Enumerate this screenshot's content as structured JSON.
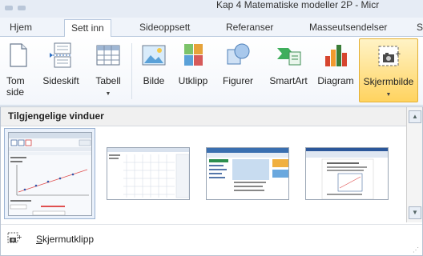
{
  "window": {
    "title": "Kap 4 Matematiske modeller 2P - Micr"
  },
  "tabs": [
    {
      "label": "Hjem",
      "active": false
    },
    {
      "label": "Sett inn",
      "active": true
    },
    {
      "label": "Sideoppsett",
      "active": false
    },
    {
      "label": "Referanser",
      "active": false
    },
    {
      "label": "Masseutsendelser",
      "active": false
    },
    {
      "label": "S",
      "active": false
    }
  ],
  "ribbon": {
    "buttons": [
      {
        "label": "Tom",
        "label2": "side",
        "icon": "blank-page-icon"
      },
      {
        "label": "Sideskift",
        "icon": "page-break-icon"
      },
      {
        "label": "Tabell",
        "icon": "table-icon",
        "dropdown": true
      },
      {
        "label": "Bilde",
        "icon": "picture-icon"
      },
      {
        "label": "Utklipp",
        "icon": "clip-art-icon"
      },
      {
        "label": "Figurer",
        "icon": "shapes-icon"
      },
      {
        "label": "SmartArt",
        "icon": "smartart-icon"
      },
      {
        "label": "Diagram",
        "icon": "chart-icon"
      },
      {
        "label": "Skjermbilde",
        "icon": "screenshot-icon",
        "dropdown": true,
        "highlighted": true
      }
    ]
  },
  "panel": {
    "header": "Tilgjengelige vinduer",
    "thumbnails": [
      {
        "name": "geogebra-window",
        "selected": true
      },
      {
        "name": "blank-grid-window",
        "selected": false
      },
      {
        "name": "browser-window",
        "selected": false
      },
      {
        "name": "word-window",
        "selected": false
      }
    ],
    "clip_label_underlined": "S",
    "clip_label_rest": "kjermutklipp"
  },
  "colors": {
    "accent_highlight": "#ffd35f",
    "panel_border": "#b9c4d2",
    "tab_border": "#b9c9de"
  }
}
